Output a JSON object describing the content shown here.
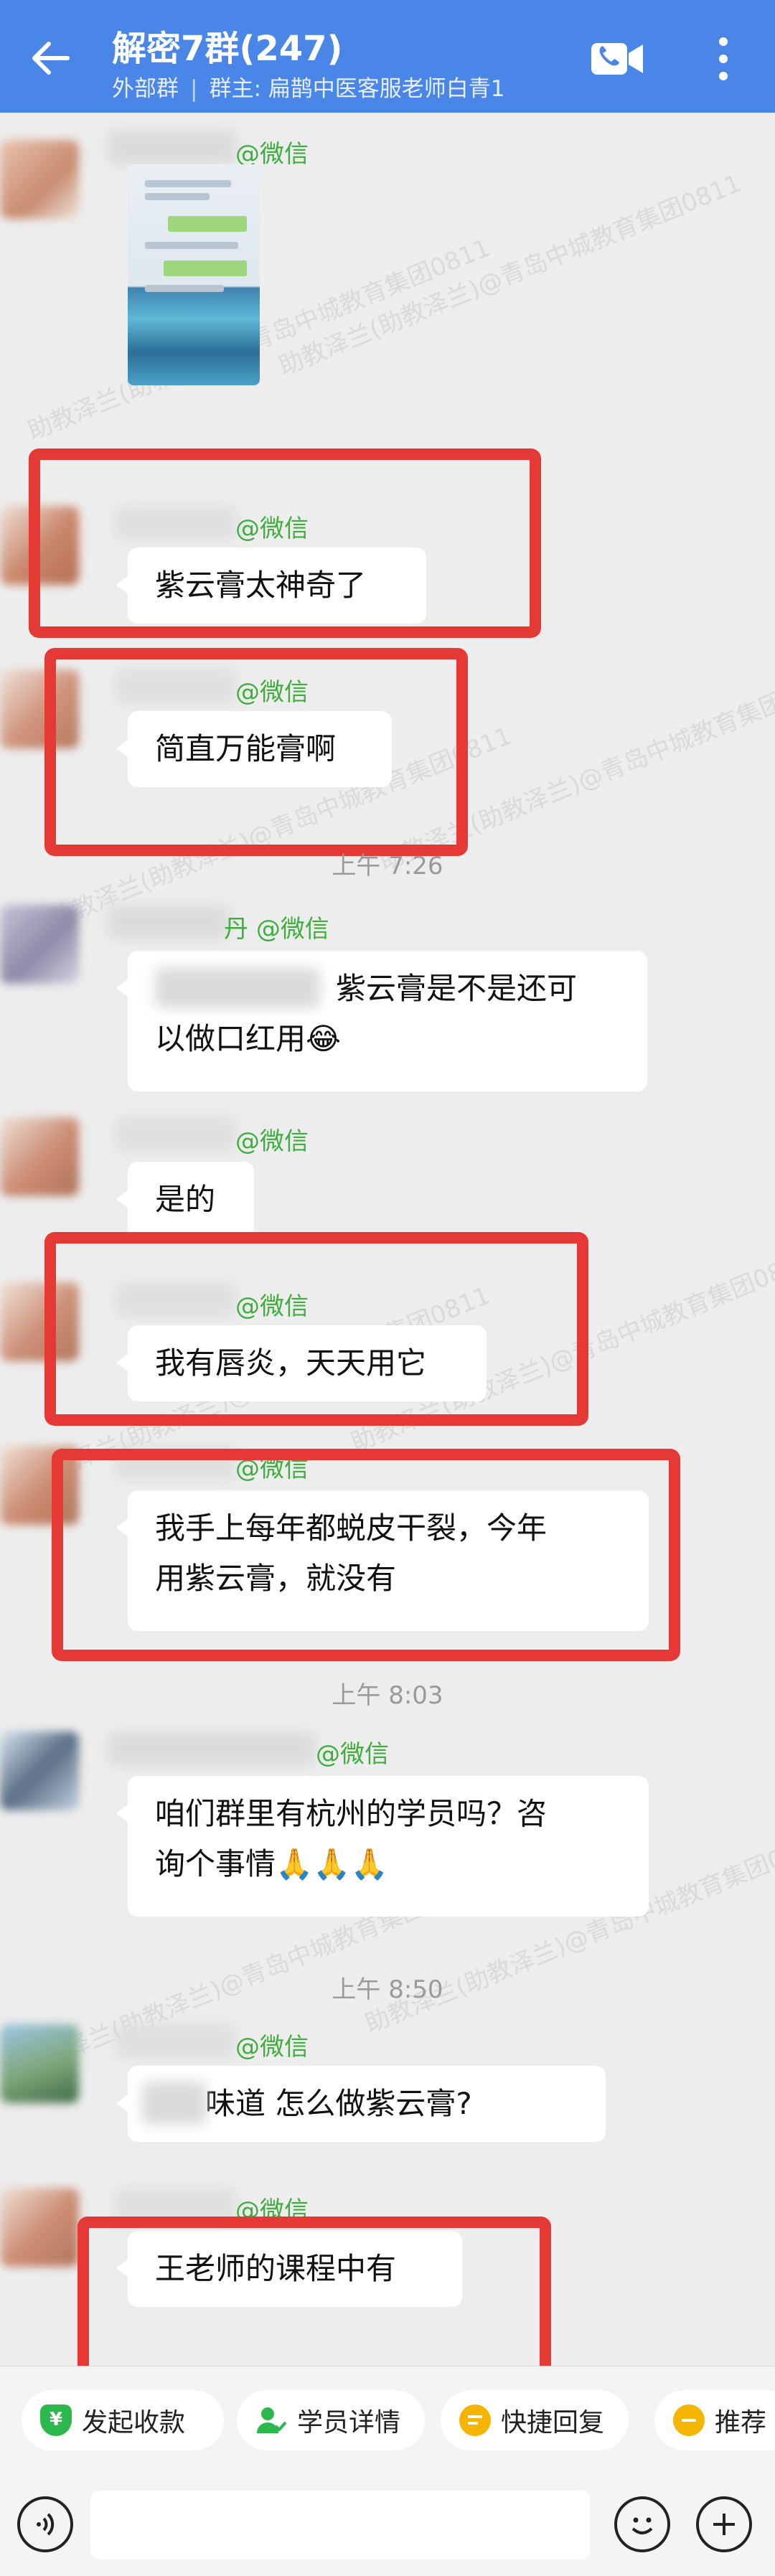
{
  "header": {
    "title": "解密7群(247)",
    "subtitle_left": "外部群",
    "subtitle_separator": "|",
    "subtitle_right": "群主: 扁鹊中医客服老师白青1"
  },
  "watermark_text": "助教泽兰(助教泽兰)@青岛中城教育集团0811",
  "messages": [
    {
      "source": "@微信",
      "type": "image"
    },
    {
      "source": "@微信",
      "text": "紫云膏太神奇了"
    },
    {
      "source": "@微信",
      "text": "简直万能膏啊"
    },
    {
      "time": "上午 7:26"
    },
    {
      "source": "@微信",
      "name_tail": "丹",
      "line1": "紫云膏是不是还可",
      "line2": "以做口红用😂"
    },
    {
      "source": "@微信",
      "text": "是的"
    },
    {
      "source": "@微信",
      "text": "我有唇炎，天天用它"
    },
    {
      "source": "@微信",
      "line1": "我手上每年都蜕皮干裂，今年",
      "line2": "用紫云膏，就没有"
    },
    {
      "time": "上午 8:03"
    },
    {
      "source": "@微信",
      "line1": "咱们群里有杭州的学员吗？咨",
      "line2": "询个事情🙏🙏🙏"
    },
    {
      "time": "上午 8:50"
    },
    {
      "source": "@微信",
      "text": "味道 怎么做紫云膏?"
    },
    {
      "source": "@微信",
      "text": "王老师的课程中有"
    }
  ],
  "quick_actions": [
    {
      "label": "发起收款",
      "icon": "shield-yen-icon",
      "color": "#2db84d"
    },
    {
      "label": "学员详情",
      "icon": "user-check-icon",
      "color": "#2db84d"
    },
    {
      "label": "快捷回复",
      "icon": "quick-reply-icon",
      "color": "#f5b400"
    },
    {
      "label": "推荐",
      "icon": "recommend-icon",
      "color": "#f5b400"
    }
  ],
  "colors": {
    "header": "#4a86e8",
    "highlight": "#e53935",
    "source": "#3fae3f"
  }
}
